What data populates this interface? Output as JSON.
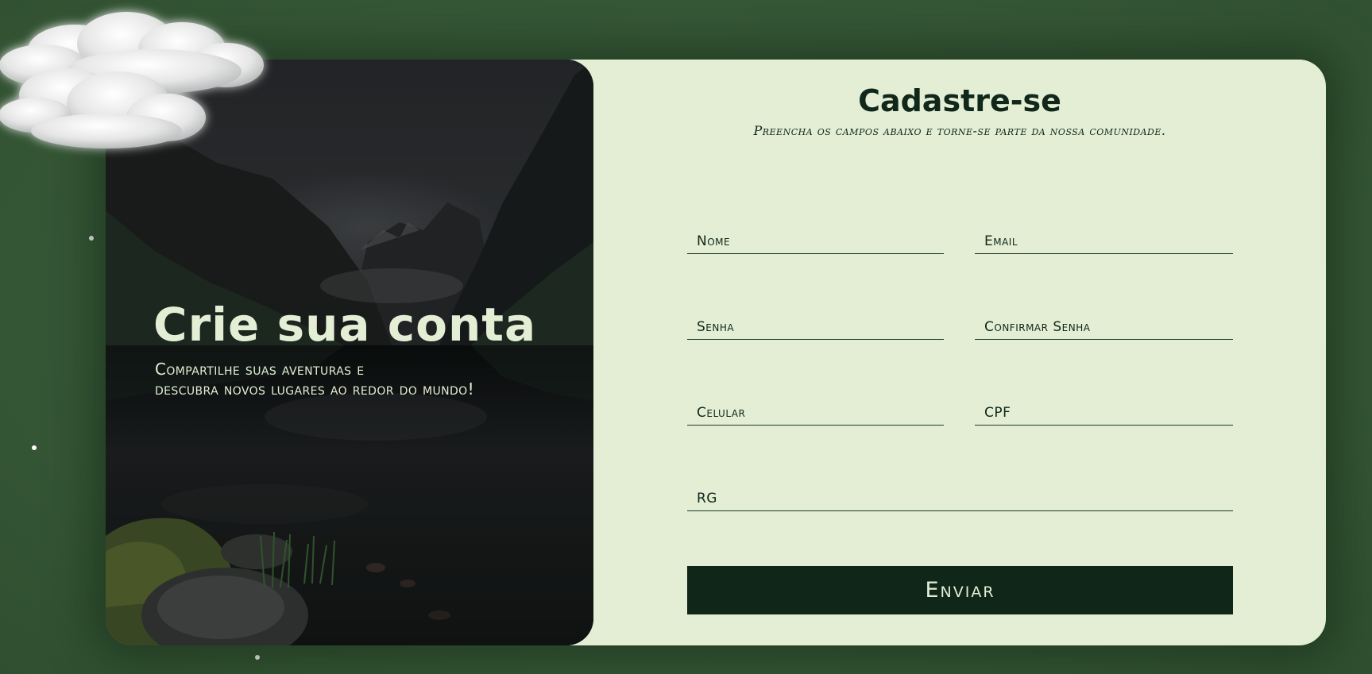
{
  "hero": {
    "title": "Crie sua conta",
    "subtitle_line1": "Compartilhe suas aventuras e",
    "subtitle_line2": "descubra novos lugares ao redor do mundo!"
  },
  "form": {
    "title": "Cadastre-se",
    "subtitle": "Preencha os campos abaixo e torne-se parte da nossa comunidade.",
    "fields": {
      "nome": {
        "placeholder": "Nome",
        "value": ""
      },
      "email": {
        "placeholder": "Email",
        "value": ""
      },
      "senha": {
        "placeholder": "Senha",
        "value": ""
      },
      "confirmar_senha": {
        "placeholder": "Confirmar Senha",
        "value": ""
      },
      "celular": {
        "placeholder": "Celular",
        "value": ""
      },
      "cpf": {
        "placeholder": "CPF",
        "value": ""
      },
      "rg": {
        "placeholder": "RG",
        "value": ""
      }
    },
    "submit_label": "Enviar"
  },
  "decor": {
    "background_image": "mountain-lake-landscape",
    "cloud_icon": "cloud-icon",
    "particle": "snow-dot"
  },
  "colors": {
    "page_background": "#385a38",
    "card_background": "#e3eed5",
    "primary_dark": "#0f2618",
    "text_light": "#e3eed5"
  }
}
